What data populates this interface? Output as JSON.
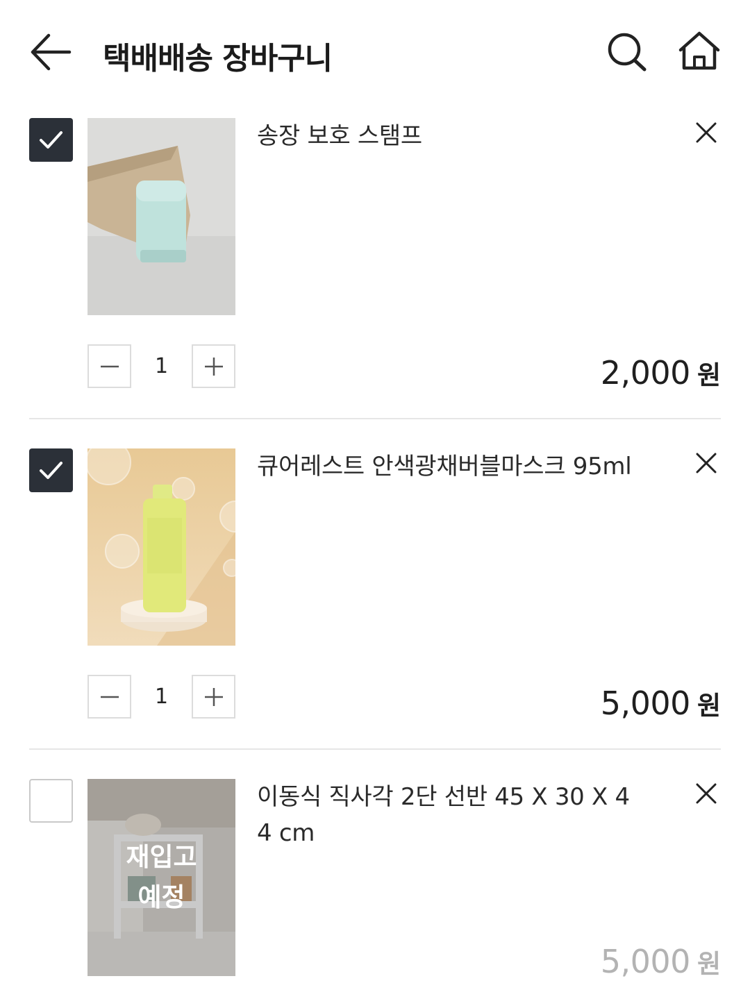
{
  "header": {
    "title": "택배배송 장바구니",
    "back_icon": "arrow-left-icon",
    "search_icon": "search-icon",
    "home_icon": "home-icon"
  },
  "items": [
    {
      "checked": true,
      "name": "송장 보호 스탬프",
      "quantity": "1",
      "price": "2,000",
      "currency": "원",
      "image": "invoice-stamp-photo"
    },
    {
      "checked": true,
      "name": "큐어레스트 안색광채버블마스크 95ml",
      "quantity": "1",
      "price": "5,000",
      "currency": "원",
      "image": "bubble-mask-photo"
    },
    {
      "checked": false,
      "name": "이동식 직사각 2단 선반 45 X 30 X 44 cm",
      "overlay": "재입고\n예정",
      "price": "5,000",
      "currency": "원",
      "image": "shelf-photo"
    }
  ],
  "colors": {
    "checkbox_checked": "#2b3038",
    "text_primary": "#1f1f1f",
    "price_disabled": "#b3b3b3",
    "divider": "#e6e6e6"
  }
}
